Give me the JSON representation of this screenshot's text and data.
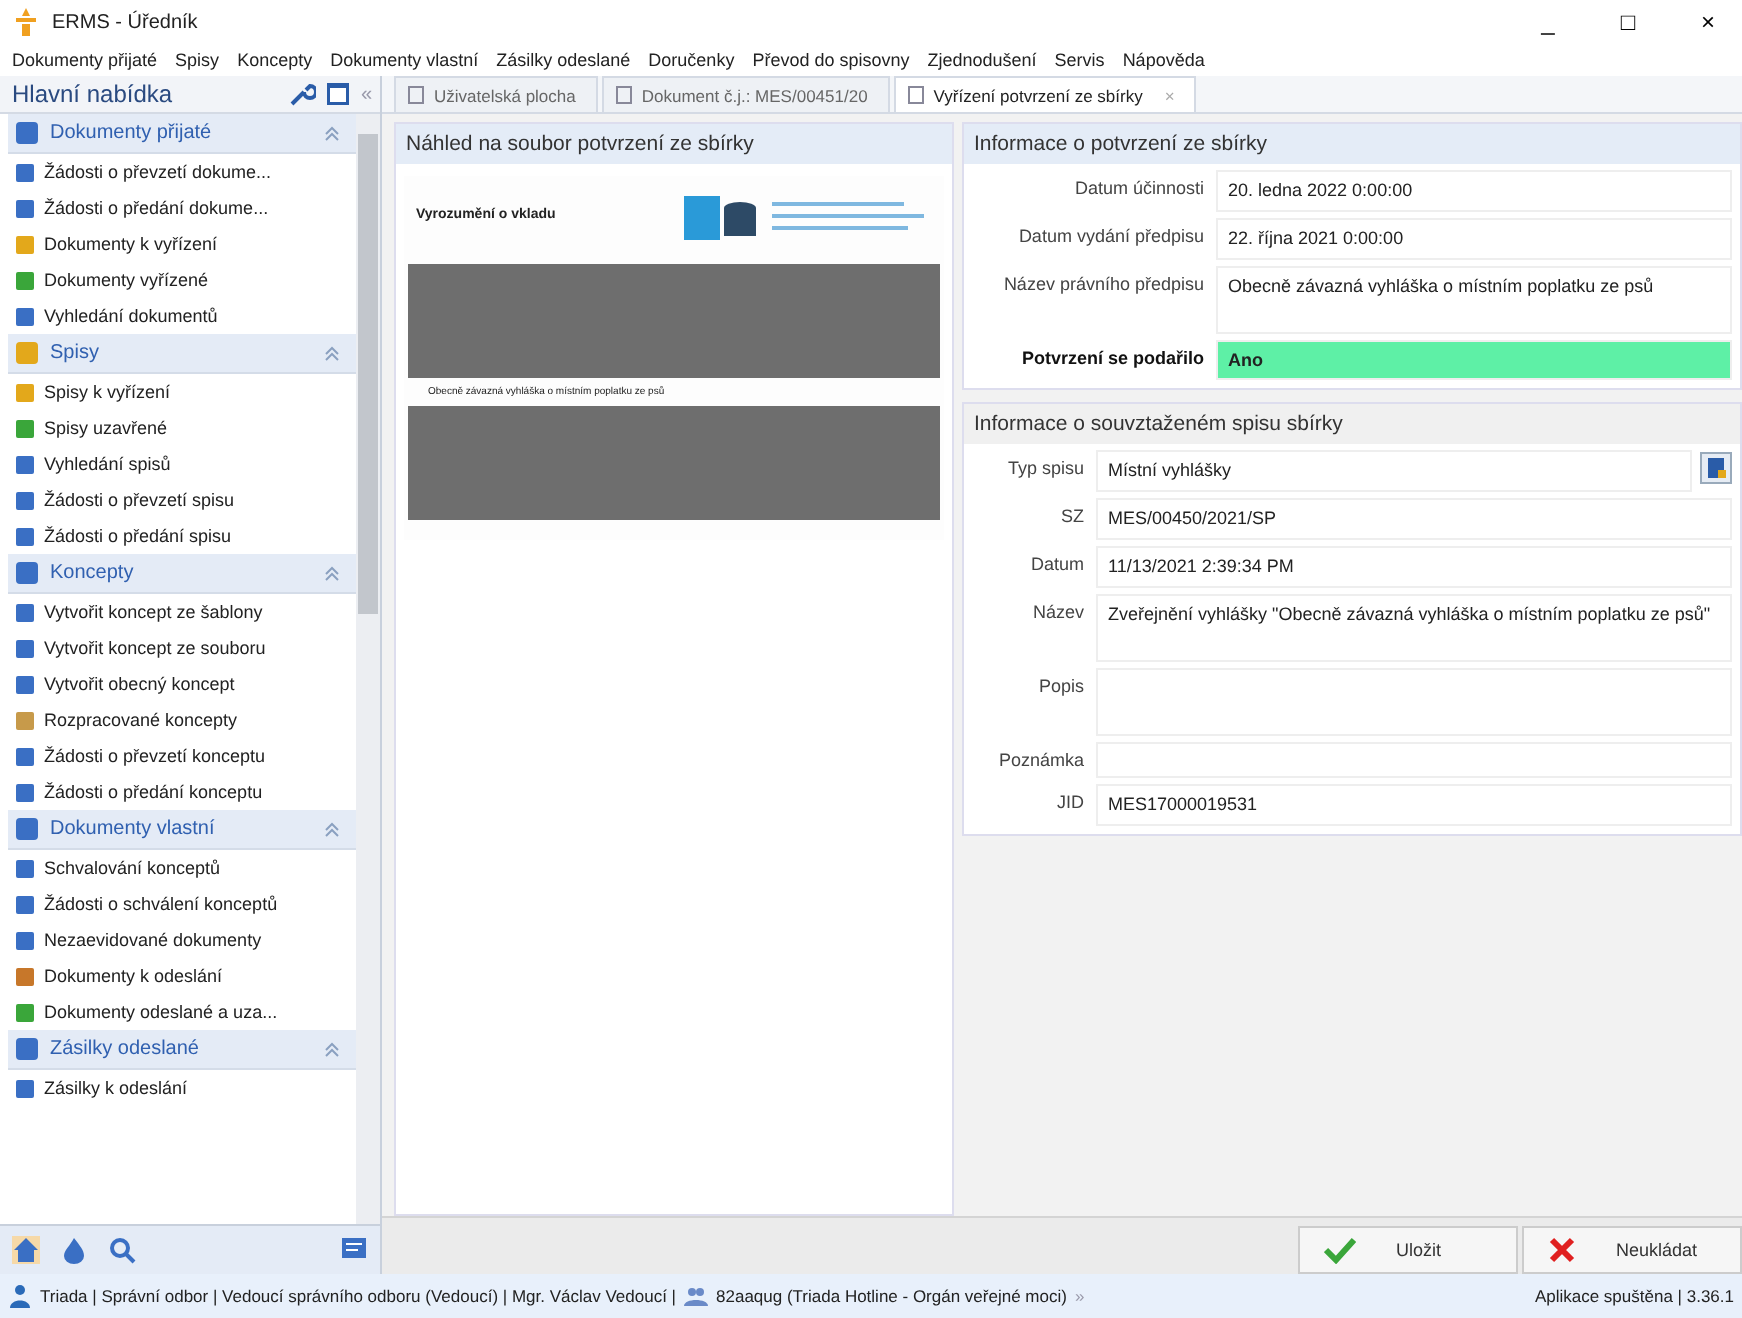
{
  "window": {
    "title": "ERMS - Úředník",
    "controls": [
      "_",
      "□",
      "×"
    ]
  },
  "menu": [
    "Dokumenty přijaté",
    "Spisy",
    "Koncepty",
    "Dokumenty vlastní",
    "Zásilky odeslané",
    "Doručenky",
    "Převod do spisovny",
    "Zjednodušení",
    "Servis",
    "Nápověda"
  ],
  "sidebar": {
    "title": "Hlavní nabídka",
    "collapse": "«",
    "groups": [
      {
        "title": "Dokumenty přijaté",
        "expanded": true,
        "items": [
          "Žádosti o převzetí dokume...",
          "Žádosti o předání dokume...",
          "Dokumenty k vyřízení",
          "Dokumenty vyřízené",
          "Vyhledání dokumentů"
        ]
      },
      {
        "title": "Spisy",
        "expanded": true,
        "items": [
          "Spisy k vyřízení",
          "Spisy uzavřené",
          "Vyhledání spisů",
          "Žádosti o převzetí spisu",
          "Žádosti o předání spisu"
        ]
      },
      {
        "title": "Koncepty",
        "expanded": true,
        "items": [
          "Vytvořit koncept ze šablony",
          "Vytvořit koncept ze souboru",
          "Vytvořit obecný koncept",
          "Rozpracované koncepty",
          "Žádosti o převzetí konceptu",
          "Žádosti o předání konceptu"
        ]
      },
      {
        "title": "Dokumenty vlastní",
        "expanded": true,
        "items": [
          "Schvalování konceptů",
          "Žádosti o schválení konceptů",
          "Nezaevidované dokumenty",
          "Dokumenty k odeslání",
          "Dokumenty odeslané a uza..."
        ]
      },
      {
        "title": "Zásilky odeslané",
        "expanded": true,
        "items": [
          "Zásilky k odeslání"
        ]
      }
    ]
  },
  "tabs": [
    {
      "label": "Uživatelská plocha",
      "selected": false
    },
    {
      "label": "Dokument č.j.: MES/00451/20",
      "selected": false
    },
    {
      "label": "Vyřízení potvrzení ze sbírky",
      "selected": true,
      "close": "×"
    }
  ],
  "preview": {
    "title": "Náhled na soubor potvrzení ze sbírky",
    "heading": "Vyrozumění o vkladu",
    "caption": "Obecně závazná vyhláška o místním poplatku ze psů"
  },
  "confirmation": {
    "title": "Informace o potvrzení ze sbírky",
    "fields": [
      {
        "label": "Datum účinnosti",
        "value": "20. ledna 2022 0:00:00"
      },
      {
        "label": "Datum vydání předpisu",
        "value": "22. října 2021 0:00:00"
      },
      {
        "label": "Název právního předpisu",
        "value": "Obecně závazná vyhláška o místním poplatku ze psů",
        "tall": true
      }
    ],
    "result": {
      "label": "Potvrzení se podařilo",
      "value": "Ano",
      "success": true
    }
  },
  "file": {
    "title": "Informace o souvztaženém spisu sbírky",
    "fields": [
      {
        "label": "Typ spisu",
        "value": "Místní vyhlášky",
        "button": true
      },
      {
        "label": "SZ",
        "value": "MES/00450/2021/SP"
      },
      {
        "label": "Datum",
        "value": "11/13/2021 2:39:34 PM"
      },
      {
        "label": "Název",
        "value": "Zveřejnění vyhlášky \"Obecně závazná vyhláška o místním poplatku ze psů\"",
        "tall": true
      },
      {
        "label": "Popis",
        "tall": true
      },
      {
        "label": "Poznámka"
      },
      {
        "label": "JID",
        "value": "MES17000019531"
      }
    ]
  },
  "buttons": [
    {
      "label": "Uložit",
      "kind": "save"
    },
    {
      "label": "Neukládat",
      "kind": "cancel"
    }
  ],
  "status_bar": {
    "left": "Triada | Správní odbor | Vedoucí správního odboru (Vedoucí) | Mgr. Václav Vedoucí |",
    "user": "82aaqug (Triada Hotline - Orgán veřejné moci)",
    "more": "»",
    "right": "Aplikace spuštěna | 3.36.1"
  }
}
